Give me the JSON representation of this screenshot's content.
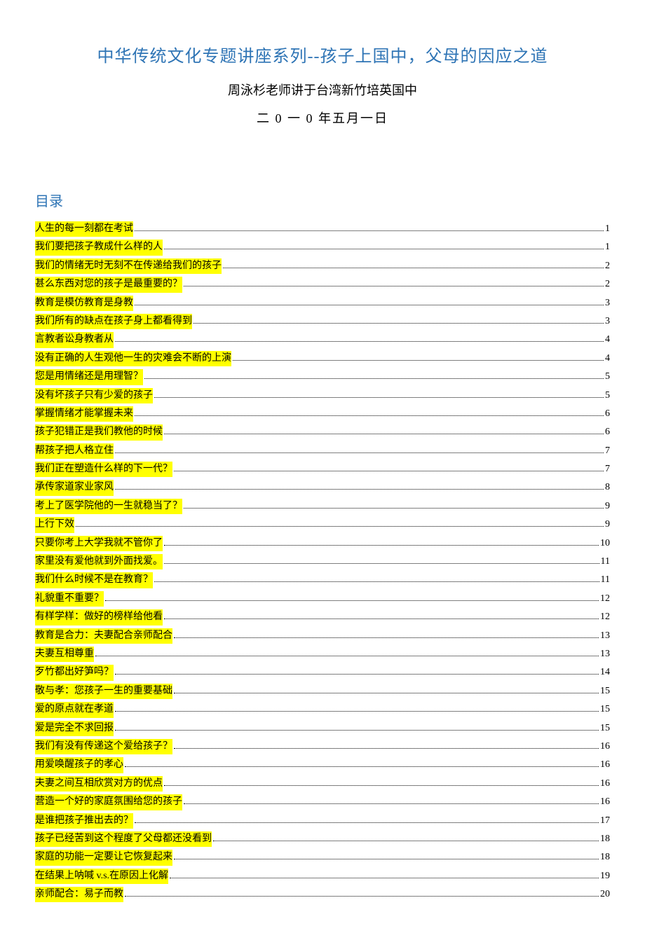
{
  "title": "中华传统文化专题讲座系列--孩子上国中，父母的因应之道",
  "subtitle": "周泳杉老师讲于台湾新竹培英国中",
  "date": "二 0 一 0 年五月一日",
  "toc_heading": "目录",
  "toc": [
    {
      "label": "人生的每一刻都在考试",
      "page": "1"
    },
    {
      "label": "我们要把孩子教成什么样的人",
      "page": "1"
    },
    {
      "label": "我们的情绪无时无刻不在传递给我们的孩子",
      "page": "2"
    },
    {
      "label": "甚么东西对您的孩子是最重要的？",
      "page": "2"
    },
    {
      "label": "教育是模仿教育是身教",
      "page": "3"
    },
    {
      "label": "我们所有的缺点在孩子身上都看得到",
      "page": "3"
    },
    {
      "label": "言教者讼身教者从",
      "page": "4"
    },
    {
      "label": "没有正确的人生观他一生的灾难会不断的上演",
      "page": "4"
    },
    {
      "label": "您是用情绪还是用理智？",
      "page": "5"
    },
    {
      "label": "没有坏孩子只有少爱的孩子",
      "page": "5"
    },
    {
      "label": "掌握情绪才能掌握未来",
      "page": "6"
    },
    {
      "label": "孩子犯错正是我们教他的时候",
      "page": "6"
    },
    {
      "label": "帮孩子把人格立住",
      "page": "7"
    },
    {
      "label": "我们正在塑造什么样的下一代？",
      "page": "7"
    },
    {
      "label": "承传家道家业家风",
      "page": "8"
    },
    {
      "label": "考上了医学院他的一生就稳当了？",
      "page": "9"
    },
    {
      "label": "上行下效",
      "page": "9"
    },
    {
      "label": "只要你考上大学我就不管你了",
      "page": "10"
    },
    {
      "label": "家里没有爱他就到外面找爱。",
      "page": "11"
    },
    {
      "label": "我们什么时候不是在教育？",
      "page": "11"
    },
    {
      "label": "礼貌重不重要？",
      "page": "12"
    },
    {
      "label": "有样学样：做好的榜样给他看",
      "page": "12"
    },
    {
      "label": "教育是合力：夫妻配合亲师配合",
      "page": "13"
    },
    {
      "label": "夫妻互相尊重",
      "page": "13"
    },
    {
      "label": "歹竹都出好笋吗？",
      "page": "14"
    },
    {
      "label": "敬与孝：您孩子一生的重要基础",
      "page": "15"
    },
    {
      "label": "爱的原点就在孝道",
      "page": "15"
    },
    {
      "label": "爱是完全不求回报",
      "page": "15"
    },
    {
      "label": "我们有没有传递这个爱给孩子？",
      "page": "16"
    },
    {
      "label": "用爱唤醒孩子的孝心",
      "page": "16"
    },
    {
      "label": "夫妻之间互相欣赏对方的优点",
      "page": "16"
    },
    {
      "label": "营造一个好的家庭氛围给您的孩子",
      "page": "16"
    },
    {
      "label": "是谁把孩子推出去的？",
      "page": "17"
    },
    {
      "label": "孩子已经苦到这个程度了父母都还没看到",
      "page": "18"
    },
    {
      "label": "家庭的功能一定要让它恢复起来",
      "page": "18"
    },
    {
      "label": "在结果上呐喊 v.s.在原因上化解",
      "page": "19"
    },
    {
      "label": "亲师配合：易子而教",
      "page": "20"
    }
  ]
}
